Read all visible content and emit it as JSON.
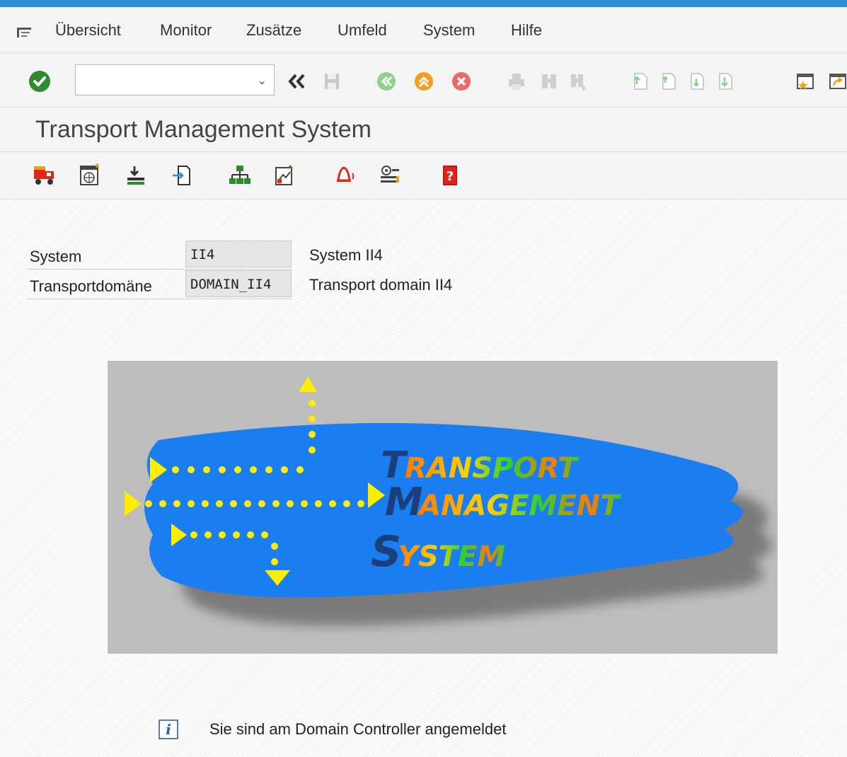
{
  "menu": {
    "items": [
      {
        "label": "Übersicht"
      },
      {
        "label": "Monitor"
      },
      {
        "label": "Zusätze"
      },
      {
        "label": "Umfeld"
      },
      {
        "label": "System"
      },
      {
        "label": "Hilfe"
      }
    ]
  },
  "toolbar": {
    "command_value": ""
  },
  "page": {
    "title": "Transport Management System"
  },
  "fields": {
    "system": {
      "label": "System",
      "value": "II4",
      "description": "System II4"
    },
    "domain": {
      "label": "Transportdomäne",
      "value": "DOMAIN_II4",
      "description": "Transport domain II4"
    }
  },
  "logo": {
    "line1_initial": "T",
    "line1_rest": "RANSPORT",
    "line2_initial": "M",
    "line2_rest": "ANAGEMENT",
    "line3_initial": "S",
    "line3_rest": "YSTEM"
  },
  "status": {
    "message": "Sie sind am Domain Controller angemeldet"
  },
  "colors": {
    "accent": "#2d8fd5",
    "ok_green": "#2e8b2e",
    "logo_blue": "#1a7df0",
    "logo_yellow": "#ffee00"
  }
}
